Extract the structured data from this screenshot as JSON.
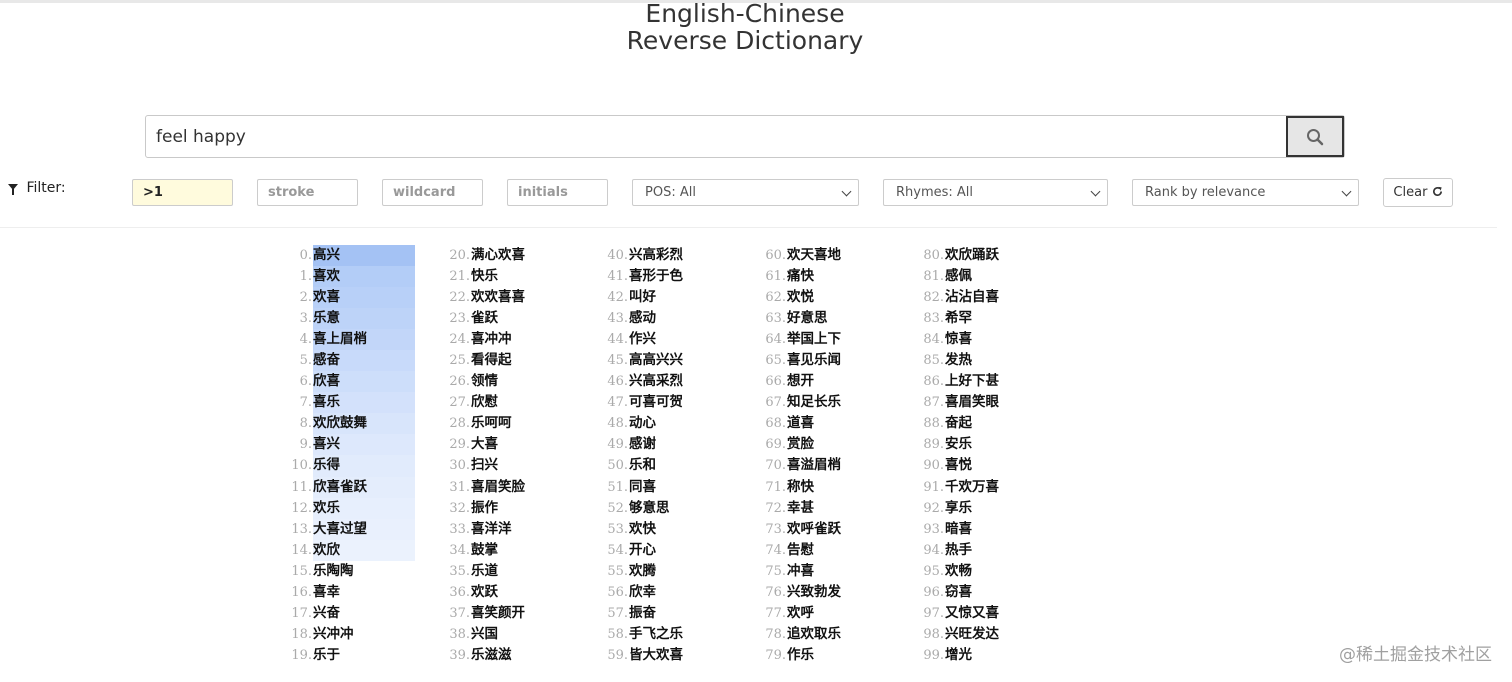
{
  "title_line1": "English-Chinese",
  "title_line2": "Reverse Dictionary",
  "search": {
    "value": "feel happy"
  },
  "filter": {
    "label": "Filter:",
    "inputs": [
      ">1",
      "stroke",
      "wildcard",
      "initials"
    ],
    "pos": "POS: All",
    "rhymes": "Rhymes: All",
    "rank": "Rank by relevance",
    "clear": "Clear"
  },
  "results": [
    "高兴",
    "喜欢",
    "欢喜",
    "乐意",
    "喜上眉梢",
    "感奋",
    "欣喜",
    "喜乐",
    "欢欣鼓舞",
    "喜兴",
    "乐得",
    "欣喜雀跃",
    "欢乐",
    "大喜过望",
    "欢欣",
    "乐陶陶",
    "喜幸",
    "兴奋",
    "兴冲冲",
    "乐于",
    "满心欢喜",
    "快乐",
    "欢欢喜喜",
    "雀跃",
    "喜冲冲",
    "看得起",
    "领情",
    "欣慰",
    "乐呵呵",
    "大喜",
    "扫兴",
    "喜眉笑脸",
    "振作",
    "喜洋洋",
    "鼓掌",
    "乐道",
    "欢跃",
    "喜笑颜开",
    "兴国",
    "乐滋滋",
    "兴高彩烈",
    "喜形于色",
    "叫好",
    "感动",
    "作兴",
    "高高兴兴",
    "兴高采烈",
    "可喜可贺",
    "动心",
    "感谢",
    "乐和",
    "同喜",
    "够意思",
    "欢快",
    "开心",
    "欢腾",
    "欣幸",
    "振奋",
    "手飞之乐",
    "皆大欢喜",
    "欢天喜地",
    "痛快",
    "欢悦",
    "好意思",
    "举国上下",
    "喜见乐闻",
    "想开",
    "知足长乐",
    "道喜",
    "赏脸",
    "喜溢眉梢",
    "称快",
    "幸甚",
    "欢呼雀跃",
    "告慰",
    "冲喜",
    "兴致勃发",
    "欢呼",
    "追欢取乐",
    "作乐",
    "欢欣踊跃",
    "感佩",
    "沾沾自喜",
    "希罕",
    "惊喜",
    "发热",
    "上好下甚",
    "喜眉笑眼",
    "奋起",
    "安乐",
    "喜悦",
    "千欢万喜",
    "享乐",
    "暗喜",
    "热手",
    "欢畅",
    "窃喜",
    "又惊又喜",
    "兴旺发达",
    "增光"
  ],
  "highlight": {
    "colors": [
      "#a4c2f4",
      "#b3cdf7",
      "#b8d0f8",
      "#bdd3f8",
      "#c2d6f9",
      "#c8dafa",
      "#cddefa",
      "#d3e1fb",
      "#d8e5fb",
      "#dde8fc",
      "#e1ebfc",
      "#e4edfc",
      "#e7effd",
      "#e9f0fd",
      "#ebf2fd"
    ]
  },
  "watermark": "@稀土掘金技术社区"
}
